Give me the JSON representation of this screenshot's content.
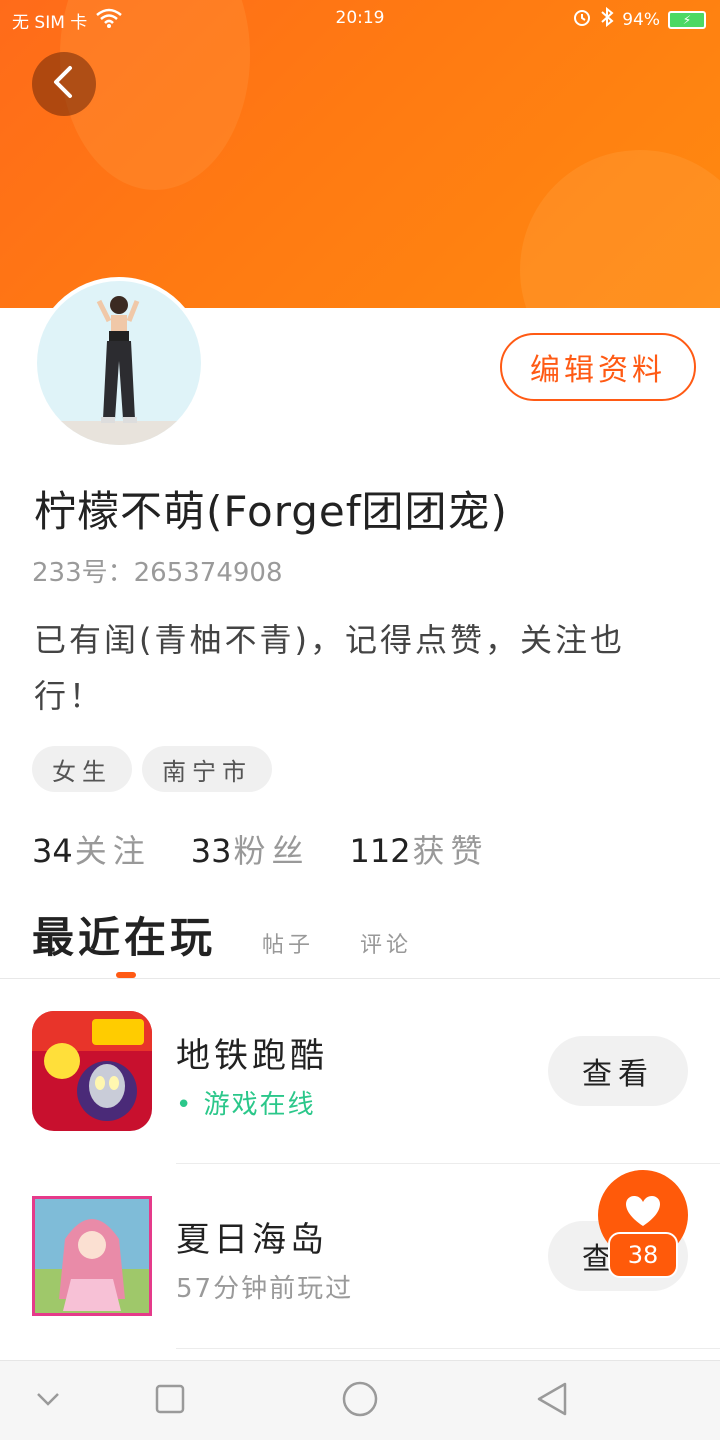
{
  "status_bar": {
    "sim": "无 SIM 卡",
    "time": "20:19",
    "battery": "94%"
  },
  "profile": {
    "name": "柠檬不萌(Forgef团团宠)",
    "uid": "233号：265374908",
    "bio": "已有闺(青柚不青)，记得点赞，关注也行！",
    "edit_label": "编辑资料",
    "tags": [
      "女生",
      "南宁市"
    ]
  },
  "stats": [
    {
      "num": "34",
      "label": "关注"
    },
    {
      "num": "33",
      "label": "粉丝"
    },
    {
      "num": "112",
      "label": "获赞"
    }
  ],
  "tabs": [
    "最近在玩",
    "帖子",
    "评论"
  ],
  "games": [
    {
      "title": "地铁跑酷",
      "sub": "游戏在线",
      "button": "查看"
    },
    {
      "title": "夏日海岛",
      "sub": "57分钟前玩过",
      "button": "查看"
    }
  ],
  "like_fab": {
    "count": "38"
  },
  "colors": {
    "accent": "#ff5a14",
    "online": "#2bc78a",
    "header": "#ff7a12"
  }
}
